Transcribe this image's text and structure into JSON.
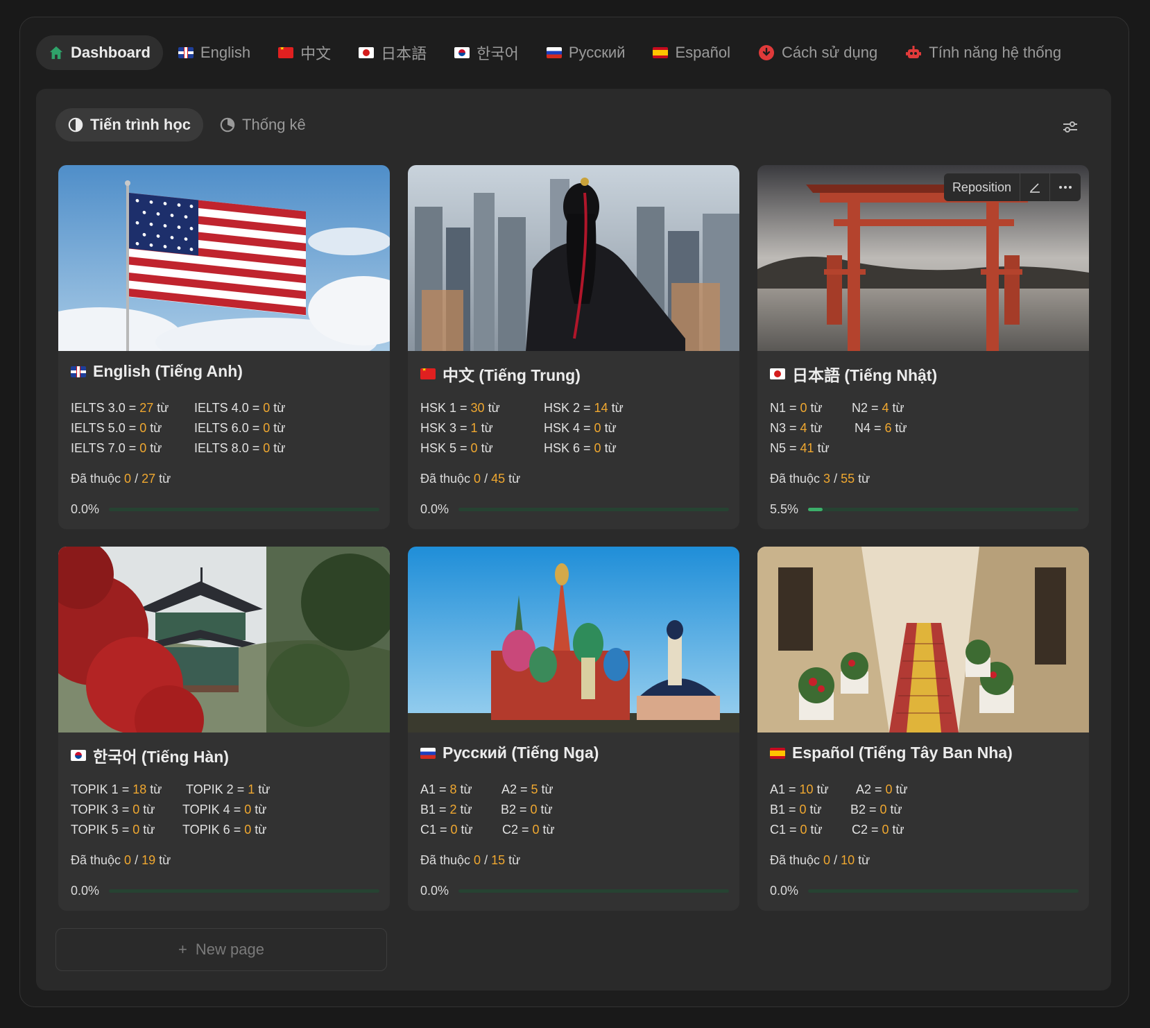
{
  "nav": {
    "dashboard": "Dashboard",
    "english": "English",
    "chinese": "中文",
    "japanese": "日本語",
    "korean": "한국어",
    "russian": "Русский",
    "spanish": "Español",
    "usage": "Cách sử dụng",
    "features": "Tính năng hệ thống"
  },
  "views": {
    "progress": "Tiến trình học",
    "stats": "Thống kê"
  },
  "cover_tools": {
    "reposition": "Reposition"
  },
  "colors": {
    "accent_orange": "#f0a830",
    "progress_green": "#3cae6a",
    "icon_red": "#e03a3a",
    "icon_green": "#2fa36a"
  },
  "cards": [
    {
      "title": "English (Tiếng Anh)",
      "levels": [
        {
          "label": "IELTS 3.0 = ",
          "count": "27",
          "unit": " từ"
        },
        {
          "label": "IELTS 4.0 = ",
          "count": "0",
          "unit": " từ"
        },
        {
          "label": "IELTS 5.0 = ",
          "count": "0",
          "unit": " từ"
        },
        {
          "label": "IELTS 6.0 = ",
          "count": "0",
          "unit": " từ"
        },
        {
          "label": "IELTS 7.0 = ",
          "count": "0",
          "unit": " từ"
        },
        {
          "label": "IELTS 8.0 = ",
          "count": "0",
          "unit": " từ"
        }
      ],
      "learned_prefix": "Đã thuộc ",
      "learned": "0",
      "sep": " / ",
      "total": "27",
      "learned_unit": " từ",
      "percent_text": "0.0%",
      "progress_fraction": 0.0
    },
    {
      "title": "中文 (Tiếng Trung)",
      "levels": [
        {
          "label": "HSK 1 = ",
          "count": "30",
          "unit": " từ"
        },
        {
          "label": "HSK 2 = ",
          "count": "14",
          "unit": " từ"
        },
        {
          "label": "HSK 3 = ",
          "count": "1",
          "unit": " từ"
        },
        {
          "label": "HSK 4 = ",
          "count": "0",
          "unit": " từ"
        },
        {
          "label": "HSK 5 = ",
          "count": "0",
          "unit": " từ"
        },
        {
          "label": "HSK 6 = ",
          "count": "0",
          "unit": " từ"
        }
      ],
      "learned_prefix": "Đã thuộc ",
      "learned": "0",
      "sep": " / ",
      "total": "45",
      "learned_unit": " từ",
      "percent_text": "0.0%",
      "progress_fraction": 0.0
    },
    {
      "title": "日本語 (Tiếng Nhật)",
      "levels": [
        {
          "label": "N1 = ",
          "count": "0",
          "unit": " từ"
        },
        {
          "label": "N2 = ",
          "count": "4",
          "unit": " từ"
        },
        {
          "label": "N3 = ",
          "count": "4",
          "unit": " từ"
        },
        {
          "label": "N4 = ",
          "count": "6",
          "unit": " từ"
        },
        {
          "label": "N5 = ",
          "count": "41",
          "unit": " từ"
        }
      ],
      "learned_prefix": "Đã thuộc ",
      "learned": "3",
      "sep": " / ",
      "total": "55",
      "learned_unit": " từ",
      "percent_text": "5.5%",
      "progress_fraction": 0.055
    },
    {
      "title": "한국어 (Tiếng Hàn)",
      "levels": [
        {
          "label": "TOPIK 1 = ",
          "count": "18",
          "unit": " từ"
        },
        {
          "label": "TOPIK 2 = ",
          "count": "1",
          "unit": " từ"
        },
        {
          "label": "TOPIK 3 = ",
          "count": "0",
          "unit": " từ"
        },
        {
          "label": "TOPIK 4 = ",
          "count": "0",
          "unit": " từ"
        },
        {
          "label": "TOPIK 5 = ",
          "count": "0",
          "unit": " từ"
        },
        {
          "label": "TOPIK 6 = ",
          "count": "0",
          "unit": " từ"
        }
      ],
      "learned_prefix": "Đã thuộc ",
      "learned": "0",
      "sep": " / ",
      "total": "19",
      "learned_unit": " từ",
      "percent_text": "0.0%",
      "progress_fraction": 0.0
    },
    {
      "title": "Русский (Tiếng Nga)",
      "levels": [
        {
          "label": "A1 = ",
          "count": "8",
          "unit": " từ"
        },
        {
          "label": "A2 = ",
          "count": "5",
          "unit": " từ"
        },
        {
          "label": "B1 = ",
          "count": "2",
          "unit": " từ"
        },
        {
          "label": "B2 = ",
          "count": "0",
          "unit": " từ"
        },
        {
          "label": "C1 = ",
          "count": "0",
          "unit": " từ"
        },
        {
          "label": "C2 = ",
          "count": "0",
          "unit": " từ"
        }
      ],
      "learned_prefix": "Đã thuộc ",
      "learned": "0",
      "sep": " / ",
      "total": "15",
      "learned_unit": " từ",
      "percent_text": "0.0%",
      "progress_fraction": 0.0
    },
    {
      "title": "Español (Tiếng Tây Ban Nha)",
      "levels": [
        {
          "label": "A1 = ",
          "count": "10",
          "unit": " từ"
        },
        {
          "label": "A2 = ",
          "count": "0",
          "unit": " từ"
        },
        {
          "label": "B1 = ",
          "count": "0",
          "unit": " từ"
        },
        {
          "label": "B2 = ",
          "count": "0",
          "unit": " từ"
        },
        {
          "label": "C1 = ",
          "count": "0",
          "unit": " từ"
        },
        {
          "label": "C2 = ",
          "count": "0",
          "unit": " từ"
        }
      ],
      "learned_prefix": "Đã thuộc ",
      "learned": "0",
      "sep": " / ",
      "total": "10",
      "learned_unit": " từ",
      "percent_text": "0.0%",
      "progress_fraction": 0.0
    }
  ],
  "new_page": "New page"
}
